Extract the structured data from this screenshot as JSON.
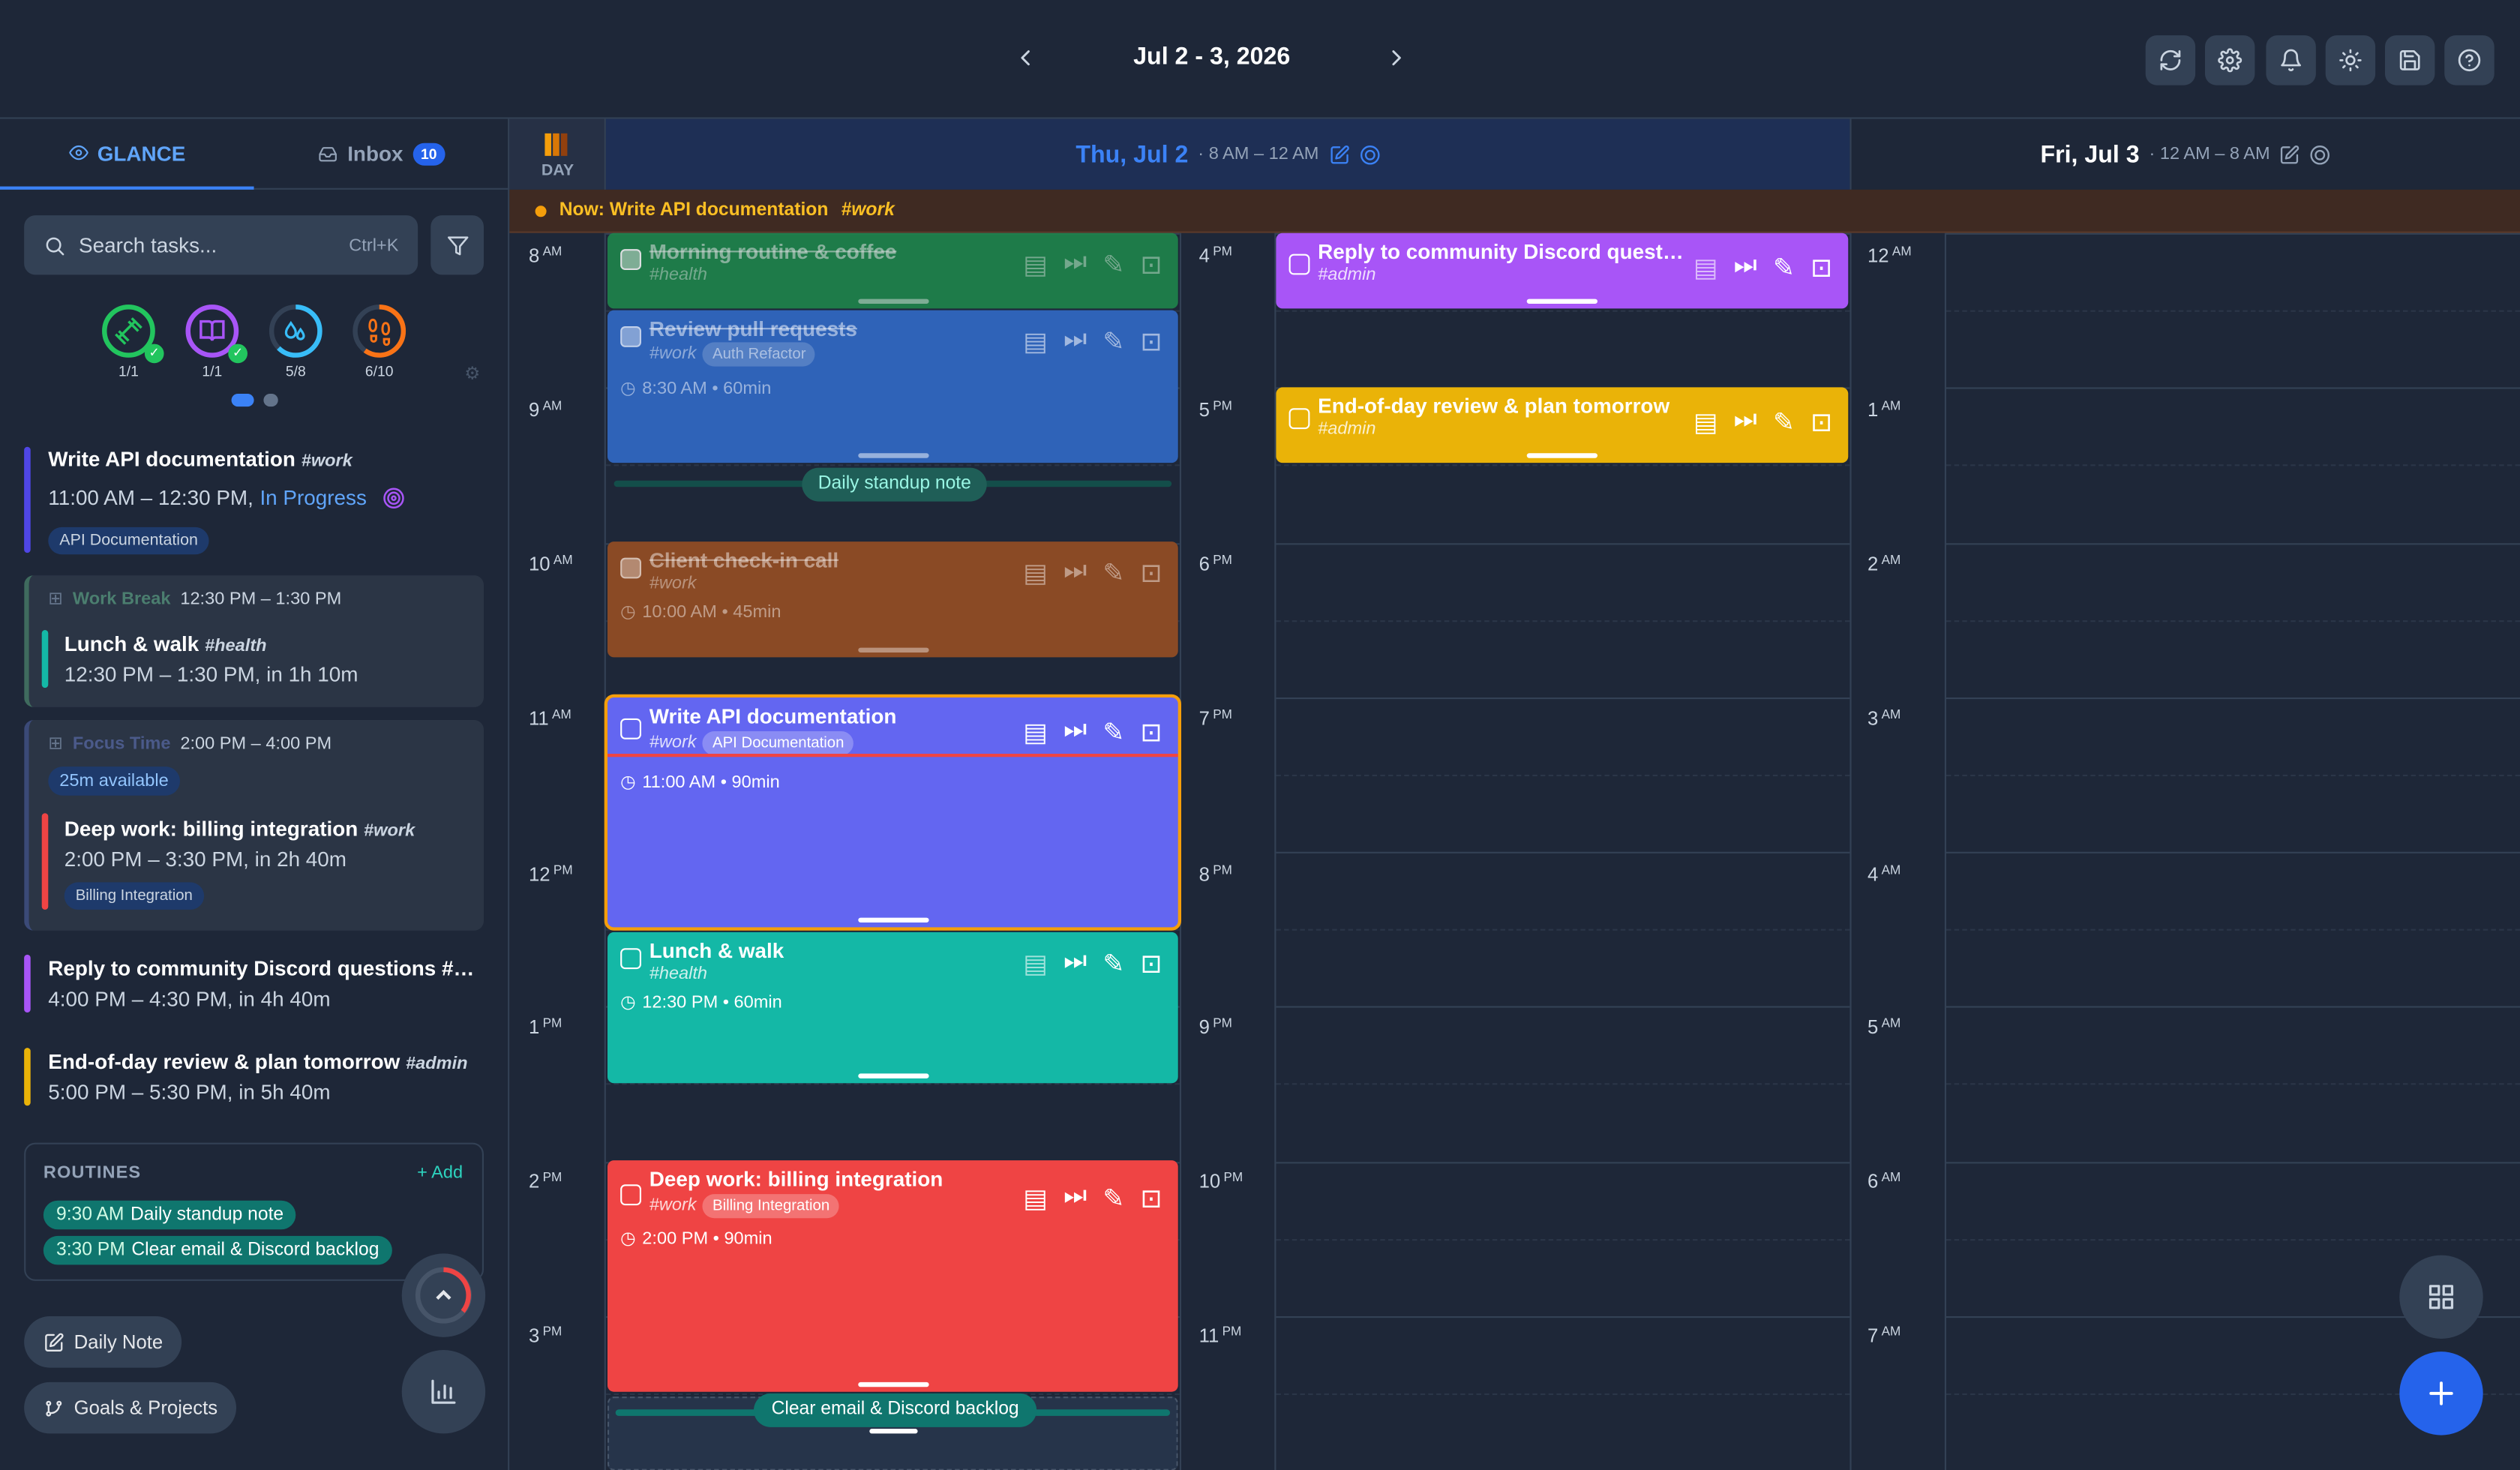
{
  "header": {
    "date_range": "Jul 2 - 3, 2026"
  },
  "tabs": {
    "glance": "GLANCE",
    "inbox": "Inbox",
    "inbox_count": "10"
  },
  "search": {
    "placeholder": "Search tasks...",
    "shortcut": "Ctrl+K"
  },
  "progress_rings": [
    {
      "label": "1/1",
      "value": 1.0,
      "color": "#22c55e",
      "icon": "dumbbell-icon"
    },
    {
      "label": "1/1",
      "value": 1.0,
      "color": "#a855f7",
      "icon": "book-icon"
    },
    {
      "label": "5/8",
      "value": 0.625,
      "color": "#38bdf8",
      "icon": "droplets-icon"
    },
    {
      "label": "6/10",
      "value": 0.6,
      "color": "#f97316",
      "icon": "footprints-icon"
    }
  ],
  "glance": {
    "current": {
      "title": "Write API documentation",
      "tag": "#work",
      "time": "11:00 AM – 12:30 PM,",
      "status": "In Progress",
      "project": "API Documentation"
    },
    "work_break": {
      "label": "Work Break",
      "time": "12:30 PM – 1:30 PM",
      "task": "Lunch & walk",
      "tag": "#health",
      "when": "12:30 PM – 1:30 PM, in 1h 10m"
    },
    "focus": {
      "label": "Focus Time",
      "time": "2:00 PM – 4:00 PM",
      "available": "25m available",
      "task": "Deep work: billing integration",
      "tag": "#work",
      "when": "2:00 PM – 3:30 PM, in 2h 40m",
      "project": "Billing Integration"
    },
    "discord": {
      "title": "Reply to community Discord questions",
      "tag": "#…",
      "when": "4:00 PM – 4:30 PM, in 4h 40m"
    },
    "review": {
      "title": "End-of-day review & plan tomorrow",
      "tag": "#admin",
      "when": "5:00 PM – 5:30 PM, in 5h 40m"
    }
  },
  "routines": {
    "title": "ROUTINES",
    "add": "+ Add",
    "items": [
      {
        "time": "9:30 AM",
        "name": "Daily standup note"
      },
      {
        "time": "3:30 PM",
        "name": "Clear email & Discord backlog"
      }
    ]
  },
  "bottom_buttons": {
    "daily_note": "Daily Note",
    "goals": "Goals & Projects"
  },
  "calendar": {
    "view_label": "DAY",
    "day1": {
      "name": "Thu, Jul 2",
      "range": "· 8 AM – 12 AM"
    },
    "day2": {
      "name": "Fri, Jul 3",
      "range": "· 12 AM – 8 AM"
    },
    "now_bar": {
      "prefix": "Now: Write API documentation",
      "tag": "#work"
    },
    "hours_col1": [
      {
        "h": "8",
        "m": "AM"
      },
      {
        "h": "9",
        "m": "AM"
      },
      {
        "h": "10",
        "m": "AM"
      },
      {
        "h": "11",
        "m": "AM"
      },
      {
        "h": "12",
        "m": "PM"
      },
      {
        "h": "1",
        "m": "PM"
      },
      {
        "h": "2",
        "m": "PM"
      },
      {
        "h": "3",
        "m": "PM"
      }
    ],
    "hours_col2": [
      {
        "h": "4",
        "m": "PM"
      },
      {
        "h": "5",
        "m": "PM"
      },
      {
        "h": "6",
        "m": "PM"
      },
      {
        "h": "7",
        "m": "PM"
      },
      {
        "h": "8",
        "m": "PM"
      },
      {
        "h": "9",
        "m": "PM"
      },
      {
        "h": "10",
        "m": "PM"
      },
      {
        "h": "11",
        "m": "PM"
      }
    ],
    "hours_col3": [
      {
        "h": "12",
        "m": "AM"
      },
      {
        "h": "1",
        "m": "AM"
      },
      {
        "h": "2",
        "m": "AM"
      },
      {
        "h": "3",
        "m": "AM"
      },
      {
        "h": "4",
        "m": "AM"
      },
      {
        "h": "5",
        "m": "AM"
      },
      {
        "h": "6",
        "m": "AM"
      },
      {
        "h": "7",
        "m": "AM"
      }
    ],
    "events": {
      "morning": {
        "title": "Morning routine & coffee",
        "tag": "#health"
      },
      "review_pr": {
        "title": "Review pull requests",
        "tag": "#work",
        "project": "Auth Refactor",
        "time": "8:30 AM • 60min"
      },
      "standup": {
        "label": "Daily standup note"
      },
      "client": {
        "title": "Client check-in call",
        "tag": "#work",
        "time": "10:00 AM • 45min"
      },
      "api": {
        "title": "Write API documentation",
        "tag": "#work",
        "project": "API Documentation",
        "time": "11:00 AM • 90min"
      },
      "lunch": {
        "title": "Lunch & walk",
        "tag": "#health",
        "time": "12:30 PM • 60min"
      },
      "deep": {
        "title": "Deep work: billing integration",
        "tag": "#work",
        "project": "Billing Integration",
        "time": "2:00 PM • 90min"
      },
      "email": {
        "label": "Clear email & Discord backlog"
      },
      "discord": {
        "title": "Reply to community Discord quest…",
        "tag": "#admin"
      },
      "eod": {
        "title": "End-of-day review & plan tomorrow",
        "tag": "#admin"
      }
    }
  },
  "colors": {
    "green": "#1f8a4c",
    "blue": "#2f63b8",
    "orange": "#c2612a",
    "indigo": "#6366f1",
    "teal": "#14b8a6",
    "red": "#ef4444",
    "purple": "#a855f7",
    "yellow": "#eab308"
  }
}
